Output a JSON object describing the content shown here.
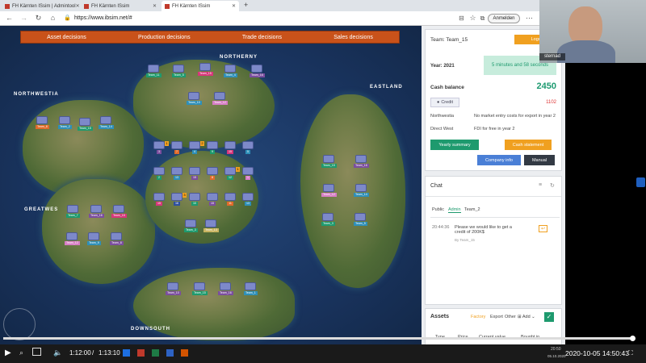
{
  "browser": {
    "tabs": [
      {
        "label": "FH Kärnten ISsim | Admintool"
      },
      {
        "label": "FH Kärnten ISsim"
      },
      {
        "label": "FH Kärnten ISsim"
      }
    ],
    "url": "https://www.ibsim.net/#",
    "signin_label": "Anmelden"
  },
  "game": {
    "menu": [
      "Asset decisions",
      "Production decisions",
      "Trade decisions",
      "Sales decisions"
    ],
    "regions": {
      "northerny": "NORTHERNY",
      "northwestia": "NORTHWESTIA",
      "eastland": "EASTLAND",
      "greatwest": "GREATWES",
      "downsouth": "DOWNSOUTH"
    },
    "units": {
      "n1": "Team_11",
      "n2": "Team_5",
      "n3": "Team_15",
      "n4": "Team_4",
      "n5": "Team_16",
      "n6": "Team_10",
      "n7": "Team_12",
      "w1": "Team_8",
      "w2": "Team_2",
      "w3": "Team_15",
      "w4": "Team_14",
      "c1": "3",
      "c2": "7",
      "c3": "4",
      "c4": "9",
      "c5": "15",
      "c6": "5",
      "c7": "2",
      "c8": "13",
      "c9": "15",
      "c10": "8",
      "c11": "12",
      "c12": "1",
      "c13": "15",
      "c14": "16",
      "c15": "10",
      "c16": "15",
      "c17": "11",
      "c18": "13",
      "c19": "Team_3",
      "c20": "Team_13",
      "gw1": "Team_7",
      "gw2": "Team_16",
      "gw3": "Team_15",
      "gw4": "Team_12",
      "gw5": "Team_9",
      "gw6": "Team_8",
      "e1": "Team_15",
      "e2": "Team_16",
      "e3": "Team_12",
      "e4": "Team_14",
      "e5": "Team_3",
      "e6": "Team_5",
      "s1": "Team_10",
      "s2": "Team_15",
      "s3": "Team_16",
      "s4": "Team_1"
    }
  },
  "panel": {
    "team_label": "Team: Team_15",
    "logout_label": "Logout",
    "year_label": "Year: 2021",
    "time_left": "5 minutes and 58 seconds",
    "cash_balance_label": "Cash balance",
    "cash_balance_value": "2450",
    "credit_label": "Credit",
    "credit_value": "1102",
    "notes": [
      {
        "region": "Northwestia",
        "text": "No market entry costs for export in year 2"
      },
      {
        "region": "Direct West",
        "text": "FDI for free in year 2"
      }
    ],
    "yearly_summary_label": "Yearly summary",
    "cash_statement_label": "Cash statement",
    "company_info_label": "Company info",
    "manual_label": "Manual",
    "chat": {
      "title": "Chat",
      "tabs": [
        "Public",
        "Admin",
        "Team_2"
      ],
      "active_tab": "Admin",
      "messages": [
        {
          "time": "20:44:36",
          "text": "Please we would like to get a credit of 200K$",
          "author": "By Team_15"
        }
      ]
    },
    "assets": {
      "title": "Assets",
      "tabs": [
        "Factory",
        "Export",
        "Other"
      ],
      "add_label": "Add",
      "columns": [
        "Type",
        "Price",
        "Current value",
        "Bought in"
      ]
    }
  },
  "video": {
    "current_time": "1:12:00",
    "separator": "/",
    "total_time": "1:13:10",
    "tray_time": "20:50",
    "tray_date": "05.10.2020",
    "timestamp": "2020-10-05 14:50:43"
  },
  "webcam": {
    "name_label": "sternad"
  },
  "colors": {
    "menu_orange": "#c9521a",
    "accent_green": "#1e9a6e",
    "cash_green": "#1d9a70",
    "credit_red": "#d33",
    "button_orange": "#f0a020",
    "button_blue": "#4a7fd6",
    "button_dark": "#333a44"
  }
}
